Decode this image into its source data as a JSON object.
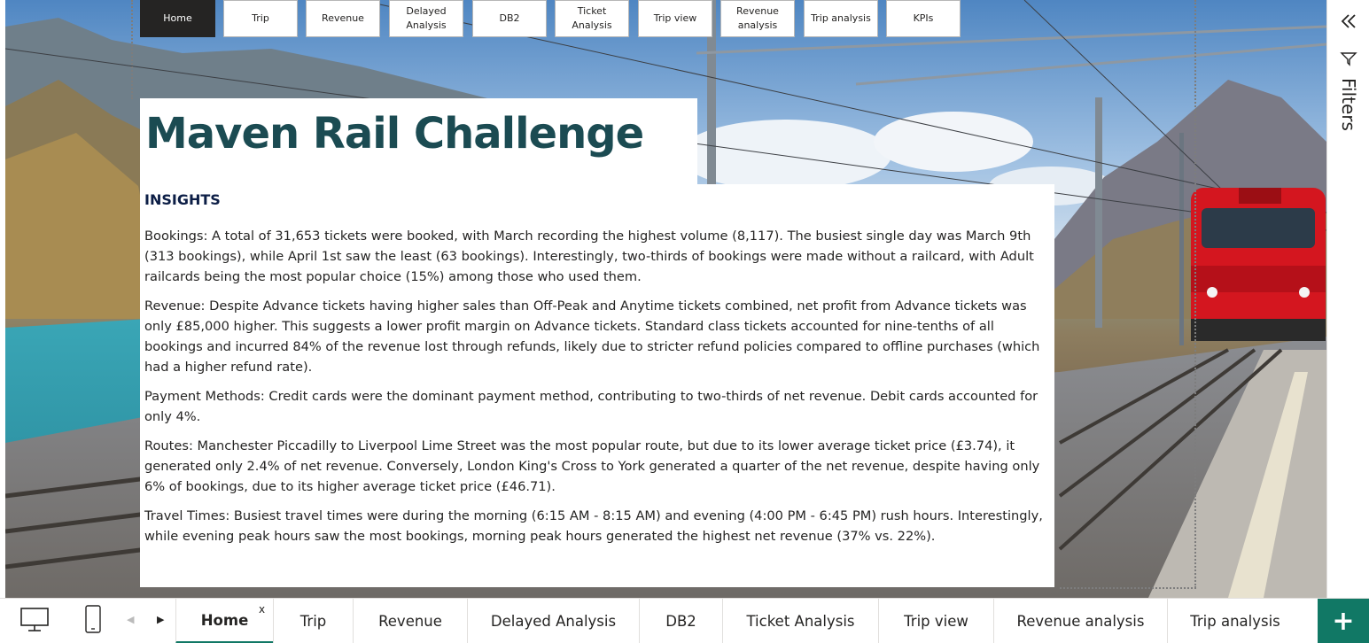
{
  "nav": {
    "buttons": [
      {
        "label": "Home",
        "active": true
      },
      {
        "label": "Trip"
      },
      {
        "label": "Revenue"
      },
      {
        "label": "Delayed\nAnalysis"
      },
      {
        "label": "DB2"
      },
      {
        "label": "Ticket Analysis"
      },
      {
        "label": "Trip view"
      },
      {
        "label": "Revenue\nanalysis"
      },
      {
        "label": "Trip analysis"
      },
      {
        "label": "KPIs"
      }
    ]
  },
  "report": {
    "title": "Maven Rail Challenge",
    "insights_heading": "INSIGHTS",
    "paragraphs": [
      "Bookings: A total of 31,653 tickets were booked, with March recording the highest volume (8,117). The busiest single day was March 9th (313 bookings), while April 1st saw the least (63 bookings). Interestingly, two-thirds of bookings were made without a railcard, with Adult railcards being the most popular choice (15%) among those who used them.",
      "Revenue: Despite Advance tickets having higher sales than Off-Peak and Anytime tickets combined, net profit from Advance tickets was only £85,000 higher. This suggests a lower profit margin on Advance tickets. Standard class tickets accounted for nine-tenths of all bookings and incurred 84% of the revenue lost through refunds, likely due to stricter refund policies compared to offline purchases (which had a higher refund rate).",
      "Payment Methods: Credit cards were the dominant payment method, contributing to two-thirds of net revenue. Debit cards accounted for only 4%.",
      "Routes: Manchester Piccadilly to Liverpool Lime Street was the most popular route, but due to its lower average ticket price (£3.74), it generated only 2.4% of net revenue. Conversely, London King's Cross to York generated a quarter of the net revenue, despite having only 6% of bookings, due to its higher average ticket price (£46.71).",
      "Travel Times: Busiest travel times were during the morning (6:15 AM - 8:15 AM) and evening (4:00 PM - 6:45 PM) rush hours. Interestingly, while evening peak hours saw the most bookings, morning peak hours generated the highest net revenue (37% vs. 22%)."
    ]
  },
  "filters": {
    "label": "Filters",
    "collapse_icon": "double-chevron-left-icon",
    "filter_icon": "funnel-icon"
  },
  "tabs": {
    "close_glyph": "x",
    "prev_glyph": "◀",
    "next_glyph": "▶",
    "add_glyph": "+",
    "pages": [
      {
        "label": "Home",
        "active": true
      },
      {
        "label": "Trip"
      },
      {
        "label": "Revenue"
      },
      {
        "label": "Delayed Analysis"
      },
      {
        "label": "DB2"
      },
      {
        "label": "Ticket Analysis"
      },
      {
        "label": "Trip view"
      },
      {
        "label": "Revenue analysis"
      },
      {
        "label": "Trip analysis"
      }
    ]
  },
  "colors": {
    "title": "#1b4b52",
    "heading": "#0c1e46",
    "accent": "#117865",
    "active_nav": "#252423",
    "train_red": "#d4161f"
  }
}
